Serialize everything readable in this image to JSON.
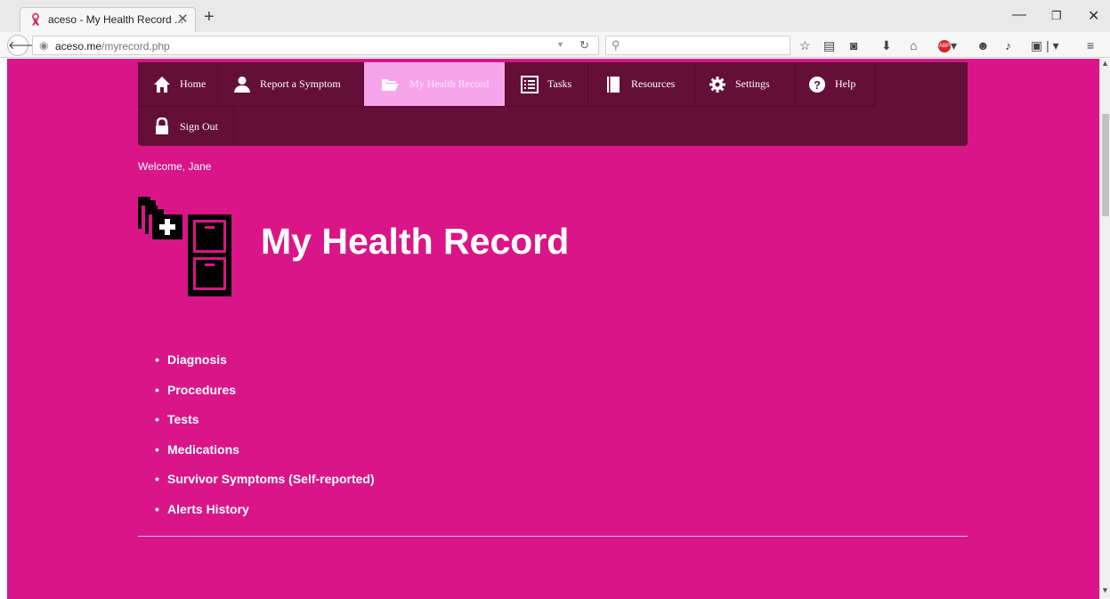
{
  "browser": {
    "tab_title": "aceso - My Health Record ...",
    "new_tab_symbol": "+",
    "url_host": "aceso.me",
    "url_path": "/myrecord.php",
    "search_placeholder": "",
    "toolbar_icons": [
      "bookmark-star-icon",
      "reading-list-icon",
      "pocket-icon",
      "download-icon",
      "home-icon",
      "adblock-icon",
      "chat-icon",
      "share-icon",
      "screenshot-icon",
      "menu-icon"
    ],
    "window_controls": [
      "minimize-icon",
      "restore-icon",
      "close-icon"
    ]
  },
  "nav": {
    "items": [
      {
        "label": "Home",
        "icon": "home-icon"
      },
      {
        "label": "Report a Symptom",
        "icon": "user-icon"
      },
      {
        "label": "My Health Record",
        "icon": "folder-open-icon",
        "active": true
      },
      {
        "label": "Tasks",
        "icon": "list-icon"
      },
      {
        "label": "Resources",
        "icon": "book-icon"
      },
      {
        "label": "Settings",
        "icon": "gear-icon"
      },
      {
        "label": "Help",
        "icon": "help-icon"
      }
    ],
    "signout": {
      "label": "Sign Out",
      "icon": "lock-icon"
    }
  },
  "welcome": "Welcome, Jane",
  "page_title": "My Health Record",
  "record_links": [
    "Diagnosis",
    "Procedures",
    "Tests",
    "Medications",
    "Survivor Symptoms (Self-reported)",
    "Alerts History"
  ],
  "colors": {
    "page_bg": "#d91588",
    "nav_bg": "#640f38",
    "nav_active": "#f7a5eb"
  }
}
